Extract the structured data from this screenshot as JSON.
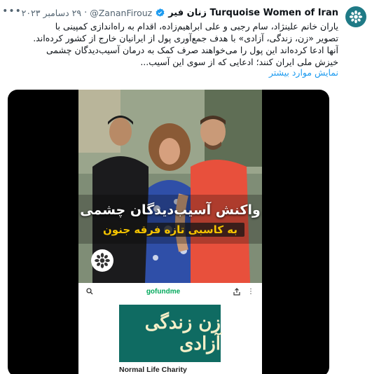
{
  "tweet": {
    "display_name": "Turquoise Women of Iran زنان فیر",
    "handle": "@ZananFirouz",
    "separator": "·",
    "date": "۲۹ دسامبر ۲۰۲۳",
    "more_icon": "more-icon",
    "body_lines": [
      "یاران خانم علینژاد، سام رجبی و علی ابراهیم‌زاده، اقدام به راه‌اندازی کمپینی با",
      "تصویر «زن، زندگی، آزادی» با هدف جمع‌آوری پول از ایرانیان خارج از کشور کرده‌اند.",
      "آنها ادعا کرده‌اند این پول را می‌خواهند صرف کمک به درمان آسیب‌دیدگان چشمی",
      "خیزش ملی ایران کنند؛ ادعایی که از سوی این آسیب..."
    ],
    "show_more": "نمایش موارد بیشتر"
  },
  "video": {
    "headline": "واکنش آسیب‌دیدگان چشمی",
    "subhead": "به کاسبی تازه فرقه جنون",
    "gofundme": {
      "logo": "gofundme",
      "campaign_title": "زن زندگی آزادی",
      "charity": "Normal Life Charity"
    }
  },
  "colors": {
    "link": "#1d9bf0",
    "secondary_text": "#536471",
    "avatar_bg": "#1f7a86",
    "subhead_text": "#f5c400",
    "campaign_bg": "#0f6b62",
    "gofundme_green": "#02a95c"
  }
}
